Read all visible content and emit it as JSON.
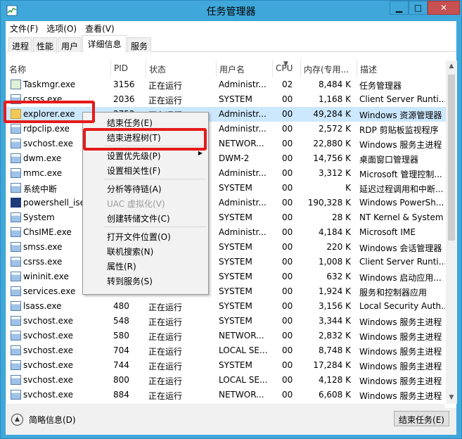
{
  "window": {
    "title": "任务管理器"
  },
  "menu": [
    "文件(F)",
    "选项(O)",
    "查看(V)"
  ],
  "tabs": [
    "进程",
    "性能",
    "用户",
    "详细信息",
    "服务"
  ],
  "columns": {
    "name": "名称",
    "pid": "PID",
    "status": "状态",
    "user": "用户名",
    "cpu": "CPU",
    "mem": "内存(专用...",
    "desc": "描述"
  },
  "rows": [
    {
      "icon": "task",
      "name": "Taskmgr.exe",
      "pid": "3156",
      "status": "正在运行",
      "user": "Administr...",
      "cpu": "02",
      "mem": "8,484 K",
      "desc": "任务管理器"
    },
    {
      "icon": "win",
      "name": "csrss.exe",
      "pid": "2036",
      "status": "正在运行",
      "user": "SYSTEM",
      "cpu": "00",
      "mem": "1,168 K",
      "desc": "Client Server Runti..."
    },
    {
      "icon": "explorer",
      "name": "explorer.exe",
      "pid": "2752",
      "status": "正在运行",
      "user": "Administr...",
      "cpu": "00",
      "mem": "49,284 K",
      "desc": "Windows 资源管理器"
    },
    {
      "icon": "win",
      "name": "rdpclip.exe",
      "pid": "",
      "status": "",
      "user": "Administr...",
      "cpu": "00",
      "mem": "2,572 K",
      "desc": "RDP 剪贴板监视程序"
    },
    {
      "icon": "win",
      "name": "svchost.exe",
      "pid": "",
      "status": "",
      "user": "NETWOR...",
      "cpu": "00",
      "mem": "22,880 K",
      "desc": "Windows 服务主进程"
    },
    {
      "icon": "win",
      "name": "dwm.exe",
      "pid": "",
      "status": "",
      "user": "DWM-2",
      "cpu": "00",
      "mem": "14,756 K",
      "desc": "桌面窗口管理器"
    },
    {
      "icon": "win",
      "name": "mmc.exe",
      "pid": "",
      "status": "",
      "user": "Administr...",
      "cpu": "00",
      "mem": "3,312 K",
      "desc": "Microsoft 管理控制..."
    },
    {
      "icon": "win",
      "name": "系统中断",
      "pid": "",
      "status": "",
      "user": "SYSTEM",
      "cpu": "00",
      "mem": "K",
      "desc": "延迟过程调用和中断..."
    },
    {
      "icon": "pwsh",
      "name": "powershell_ise.",
      "pid": "",
      "status": "",
      "user": "Administr...",
      "cpu": "00",
      "mem": "190,328 K",
      "desc": "Windows PowerSh..."
    },
    {
      "icon": "win",
      "name": "System",
      "pid": "",
      "status": "",
      "user": "SYSTEM",
      "cpu": "00",
      "mem": "28 K",
      "desc": "NT Kernel & System"
    },
    {
      "icon": "win",
      "name": "ChsIME.exe",
      "pid": "",
      "status": "",
      "user": "Administr...",
      "cpu": "00",
      "mem": "4,184 K",
      "desc": "Microsoft IME"
    },
    {
      "icon": "win",
      "name": "smss.exe",
      "pid": "",
      "status": "",
      "user": "SYSTEM",
      "cpu": "00",
      "mem": "220 K",
      "desc": "Windows 会话管理器"
    },
    {
      "icon": "win",
      "name": "csrss.exe",
      "pid": "",
      "status": "",
      "user": "SYSTEM",
      "cpu": "00",
      "mem": "1,008 K",
      "desc": "Client Server Runti..."
    },
    {
      "icon": "win",
      "name": "wininit.exe",
      "pid": "",
      "status": "",
      "user": "SYSTEM",
      "cpu": "00",
      "mem": "632 K",
      "desc": "Windows 启动应用..."
    },
    {
      "icon": "win",
      "name": "services.exe",
      "pid": "",
      "status": "",
      "user": "SYSTEM",
      "cpu": "00",
      "mem": "1,924 K",
      "desc": "服务和控制器应用"
    },
    {
      "icon": "win",
      "name": "lsass.exe",
      "pid": "480",
      "status": "正在运行",
      "user": "SYSTEM",
      "cpu": "00",
      "mem": "3,156 K",
      "desc": "Local Security Auth..."
    },
    {
      "icon": "win",
      "name": "svchost.exe",
      "pid": "548",
      "status": "正在运行",
      "user": "SYSTEM",
      "cpu": "00",
      "mem": "3,344 K",
      "desc": "Windows 服务主进程"
    },
    {
      "icon": "win",
      "name": "svchost.exe",
      "pid": "580",
      "status": "正在运行",
      "user": "NETWOR...",
      "cpu": "00",
      "mem": "2,832 K",
      "desc": "Windows 服务主进程"
    },
    {
      "icon": "win",
      "name": "svchost.exe",
      "pid": "704",
      "status": "正在运行",
      "user": "LOCAL SE...",
      "cpu": "00",
      "mem": "8,748 K",
      "desc": "Windows 服务主进程"
    },
    {
      "icon": "win",
      "name": "svchost.exe",
      "pid": "744",
      "status": "正在运行",
      "user": "SYSTEM",
      "cpu": "00",
      "mem": "17,284 K",
      "desc": "Windows 服务主进程"
    },
    {
      "icon": "win",
      "name": "svchost.exe",
      "pid": "800",
      "status": "正在运行",
      "user": "LOCAL SE...",
      "cpu": "00",
      "mem": "4,128 K",
      "desc": "Windows 服务主进程"
    },
    {
      "icon": "win",
      "name": "svchost.exe",
      "pid": "884",
      "status": "正在运行",
      "user": "NETWOR...",
      "cpu": "00",
      "mem": "6,608 K",
      "desc": "Windows 服务主进程"
    }
  ],
  "selected_row": 2,
  "context_menu": [
    {
      "label": "结束任务(E)",
      "disabled": false,
      "submenu": false
    },
    {
      "label": "结束进程树(T)",
      "disabled": false,
      "submenu": false
    },
    {
      "sep": true
    },
    {
      "label": "设置优先级(P)",
      "disabled": false,
      "submenu": true
    },
    {
      "label": "设置相关性(F)",
      "disabled": false,
      "submenu": false
    },
    {
      "sep": true
    },
    {
      "label": "分析等待链(A)",
      "disabled": false,
      "submenu": false
    },
    {
      "label": "UAC 虚拟化(V)",
      "disabled": true,
      "submenu": false
    },
    {
      "label": "创建转储文件(C)",
      "disabled": false,
      "submenu": false
    },
    {
      "sep": true
    },
    {
      "label": "打开文件位置(O)",
      "disabled": false,
      "submenu": false
    },
    {
      "label": "联机搜索(N)",
      "disabled": false,
      "submenu": false
    },
    {
      "label": "属性(R)",
      "disabled": false,
      "submenu": false
    },
    {
      "label": "转到服务(S)",
      "disabled": false,
      "submenu": false
    }
  ],
  "footer": {
    "fewer_details": "简略信息(D)",
    "end_task": "结束任务(E)"
  },
  "colors": {
    "frame": "#3fa7d9",
    "selection": "#cce8ff",
    "highlight": "#e51a1a",
    "close": "#c75050"
  }
}
